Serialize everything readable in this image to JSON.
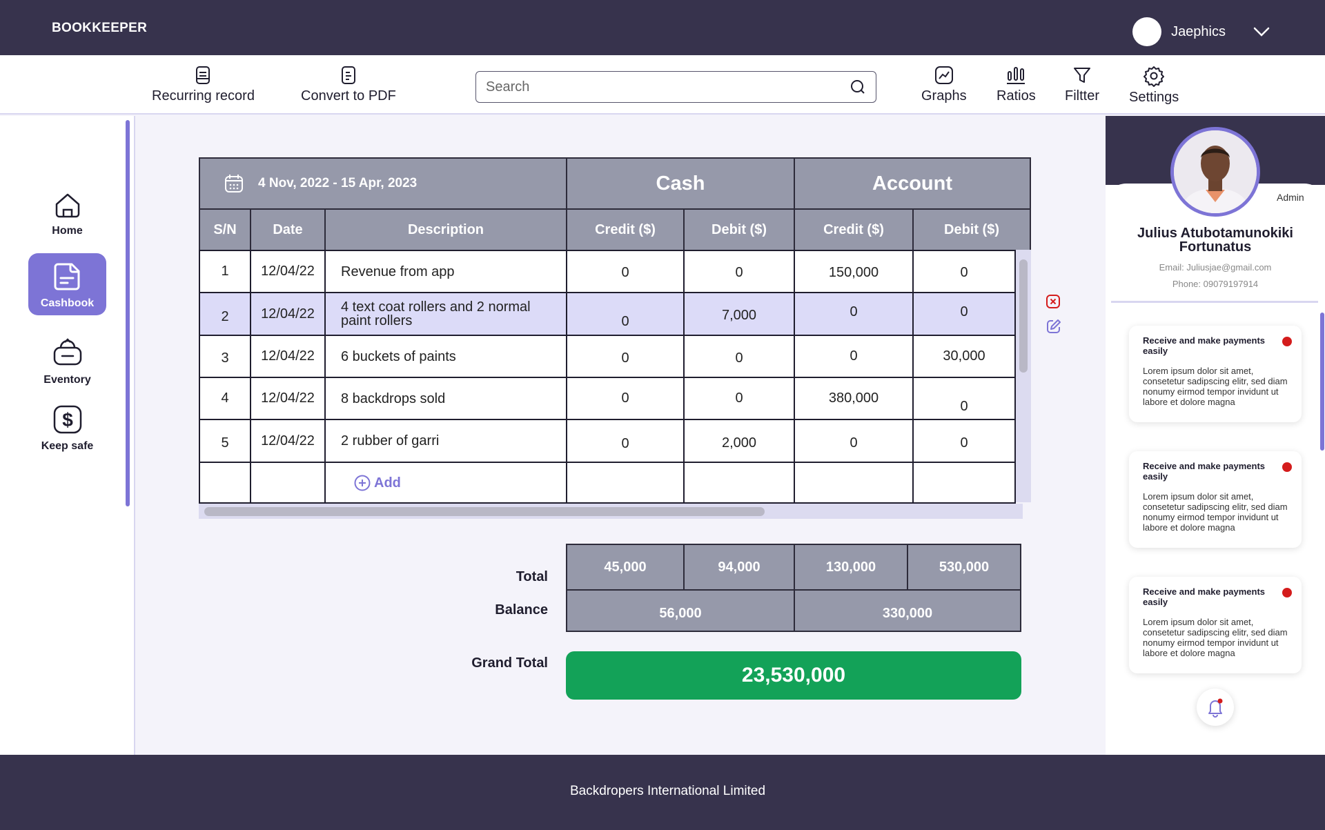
{
  "app": {
    "brand": "BOOKKEEPER"
  },
  "user": {
    "name": "Jaephics"
  },
  "toolbar": {
    "recurring_label": "Recurring record",
    "convert_label": "Convert to PDF",
    "search_placeholder": "Search",
    "graphs_label": "Graphs",
    "ratios_label": "Ratios",
    "filter_label": "Filtter",
    "settings_label": "Settings"
  },
  "sidebar": {
    "items": [
      {
        "label": "Home",
        "icon": "home-icon"
      },
      {
        "label": "Cashbook",
        "icon": "cashbook-icon",
        "active": true
      },
      {
        "label": "Eventory",
        "icon": "inventory-icon"
      },
      {
        "label": "Keep safe",
        "icon": "dollar-icon"
      }
    ]
  },
  "ledger": {
    "date_range": "4 Nov, 2022 - 15 Apr, 2023",
    "group_headers": {
      "cash": "Cash",
      "account": "Account"
    },
    "columns": [
      "S/N",
      "Date",
      "Description",
      "Credit ($)",
      "Debit ($)",
      "Credit ($)",
      "Debit ($)"
    ],
    "rows": [
      {
        "sn": "1",
        "date": "12/04/22",
        "description": "Revenue from app",
        "cash_credit": "0",
        "cash_debit": "0",
        "account_credit": "150,000",
        "account_debit": "0"
      },
      {
        "sn": "2",
        "date": "12/04/22",
        "description": "4 text coat rollers and 2 normal paint rollers",
        "cash_credit": "0",
        "cash_debit": "7,000",
        "account_credit": "0",
        "account_debit": "0"
      },
      {
        "sn": "3",
        "date": "12/04/22",
        "description": "6 buckets of paints",
        "cash_credit": "0",
        "cash_debit": "0",
        "account_credit": "0",
        "account_debit": "30,000"
      },
      {
        "sn": "4",
        "date": "12/04/22",
        "description": "8 backdrops sold",
        "cash_credit": "0",
        "cash_debit": "0",
        "account_credit": "380,000",
        "account_debit": "0"
      },
      {
        "sn": "5",
        "date": "12/04/22",
        "description": "2 rubber of garri",
        "cash_credit": "0",
        "cash_debit": "2,000",
        "account_credit": "0",
        "account_debit": "0"
      }
    ],
    "add_label": "Add"
  },
  "summary": {
    "total_label": "Total",
    "balance_label": "Balance",
    "grand_total_label": "Grand Total",
    "totals": [
      "45,000",
      "94,000",
      "130,000",
      "530,000"
    ],
    "balances": [
      "56,000",
      "330,000"
    ],
    "grand_total": "23,530,000"
  },
  "profile": {
    "role": "Admin",
    "name": "Julius Atubotamunokiki Fortunatus",
    "email": "Email: Juliusjae@gmail.com",
    "phone": "Phone: 09079197914"
  },
  "notifications": [
    {
      "title": "Receive and make payments easily",
      "body": "Lorem ipsum dolor sit amet, consetetur sadipscing elitr, sed diam nonumy eirmod tempor invidunt ut labore et dolore magna"
    },
    {
      "title": "Receive and make payments easily",
      "body": "Lorem ipsum dolor sit amet, consetetur sadipscing elitr, sed diam nonumy eirmod tempor invidunt ut labore et dolore magna"
    },
    {
      "title": "Receive and make payments easily",
      "body": "Lorem ipsum dolor sit amet, consetetur sadipscing elitr, sed diam nonumy eirmod tempor invidunt ut labore et dolore magna"
    }
  ],
  "footer": {
    "company": "Backdropers International Limited"
  },
  "colors": {
    "primary": "#37334d",
    "accent": "#7d74d6",
    "header_gray": "#9699aa",
    "success": "#13a258",
    "alert": "#d41c1c"
  }
}
